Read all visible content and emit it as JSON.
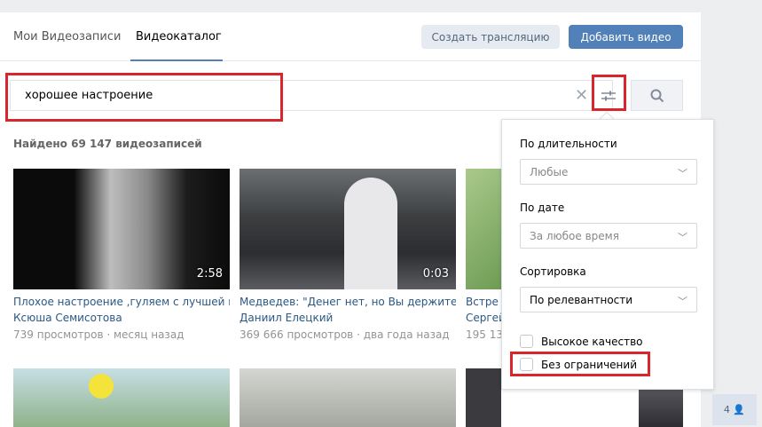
{
  "tabs": [
    "Мои Видеозаписи",
    "Видеокаталог"
  ],
  "buttons": {
    "create_stream": "Создать трансляцию",
    "add_video": "Добавить видео"
  },
  "search": {
    "value": "хорошее настроение"
  },
  "found_text": "Найдено 69 147 видеозаписей",
  "videos": [
    {
      "duration": "2:58",
      "title": "Плохое настроение ,гуляем с лучшей п...",
      "author": "Ксюша Семисотова",
      "views": "739 просмотров",
      "age": "месяц назад"
    },
    {
      "duration": "0:03",
      "title": "Медведев: \"Денег нет, но Вы держитес...",
      "author": "Даниил Елецкий",
      "views": "369 666 просмотров",
      "age": "два года назад"
    },
    {
      "title": "Встре",
      "author": "Сергей",
      "views": "195 13"
    }
  ],
  "filters": {
    "duration_label": "По длительности",
    "duration_value": "Любые",
    "date_label": "По дате",
    "date_value": "За любое время",
    "sort_label": "Сортировка",
    "sort_value": "По релевантности",
    "hq_label": "Высокое качество",
    "unlimited_label": "Без ограничений"
  },
  "side_badge": "4",
  "colors": {
    "accent": "#5181b8",
    "highlight": "#d8262c",
    "link": "#2a5885"
  }
}
